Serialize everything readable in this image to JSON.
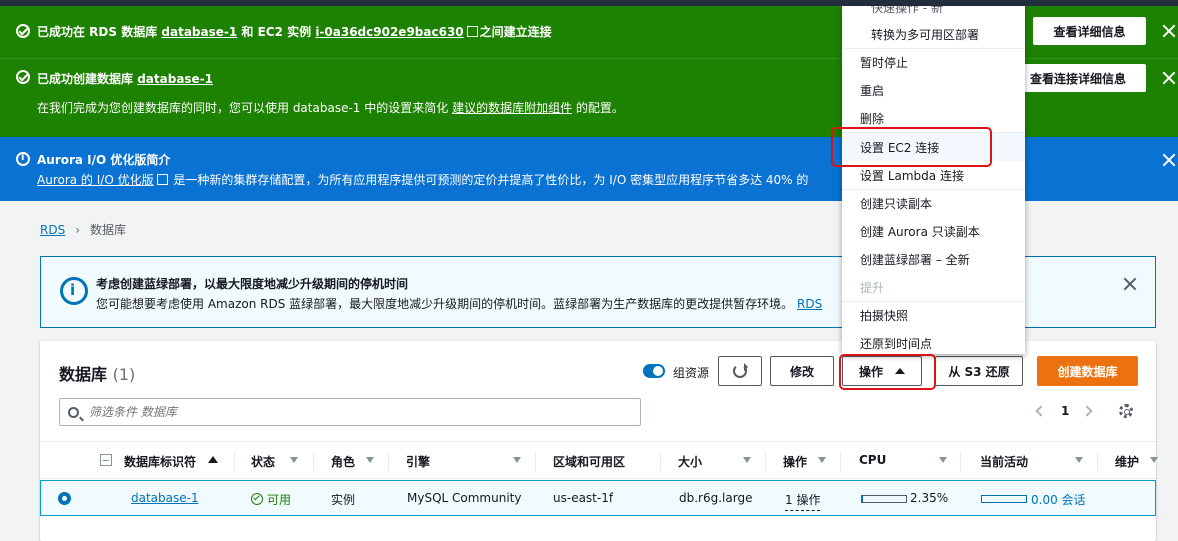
{
  "flash1": {
    "text_prefix": "已成功在 RDS 数据库",
    "db_link": "database-1",
    "mid": "和 EC2 实例",
    "ec2_link": "i-0a36dc902e9bac630",
    "suffix": "之间建立连接",
    "button": "查看详细信息"
  },
  "flash2": {
    "title_prefix": "已成功创建数据库",
    "db_link": "database-1",
    "body_prefix": "在我们完成为您创建数据库的同时，您可以使用 database-1 中的设置来简化",
    "body_link": "建议的数据库附加组件",
    "body_suffix": "的配置。",
    "button": "查看连接详细信息"
  },
  "flash3": {
    "title": "Aurora I/O 优化版简介",
    "link": "Aurora 的 I/O 优化版",
    "body": "是一种新的集群存储配置，为所有应用程序提供可预测的定价并提高了性价比，为 I/O 密集型应用程序节省多达 40% 的"
  },
  "breadcrumb": {
    "rds": "RDS",
    "current": "数据库"
  },
  "info_panel": {
    "title": "考虑创建蓝绿部署，以最大限度地减少升级期间的停机时间",
    "body": "您可能想要考虑使用 Amazon RDS 蓝绿部署，最大限度地减少升级期间的停机时间。蓝绿部署为生产数据库的更改提供暂存环境。",
    "link": "RDS"
  },
  "db_panel": {
    "title": "数据库",
    "count": "(1)",
    "toggle_label": "组资源",
    "modify": "修改",
    "actions": "操作",
    "restore_s3": "从 S3 还原",
    "create": "创建数据库",
    "search_placeholder": "筛选条件 数据库",
    "page": "1"
  },
  "columns": {
    "id": "数据库标识符",
    "status": "状态",
    "role": "角色",
    "engine": "引擎",
    "region": "区域和可用区",
    "size": "大小",
    "actions": "操作",
    "cpu": "CPU",
    "activity": "当前活动",
    "maintenance": "维护"
  },
  "row": {
    "id": "database-1",
    "status": "可用",
    "role": "实例",
    "engine": "MySQL Community",
    "region": "us-east-1f",
    "size": "db.r6g.large",
    "actions": "1 操作",
    "cpu": "2.35%",
    "cpu_fraction": 0.0235,
    "activity": "0.00 会话"
  },
  "dropdown": {
    "cutoff": "快速操作 - 新",
    "items": [
      "转换为多可用区部署",
      "暂时停止",
      "重启",
      "删除",
      "设置 EC2 连接",
      "设置 Lambda 连接",
      "创建只读副本",
      "创建 Aurora 只读副本",
      "创建蓝绿部署 – 全新",
      "提升",
      "拍摄快照",
      "还原到时间点"
    ]
  },
  "colors": {
    "success": "#1d8102",
    "info": "#0972d3",
    "primary": "#ec7211",
    "link": "#0073bb",
    "highlight": "#d91515"
  }
}
